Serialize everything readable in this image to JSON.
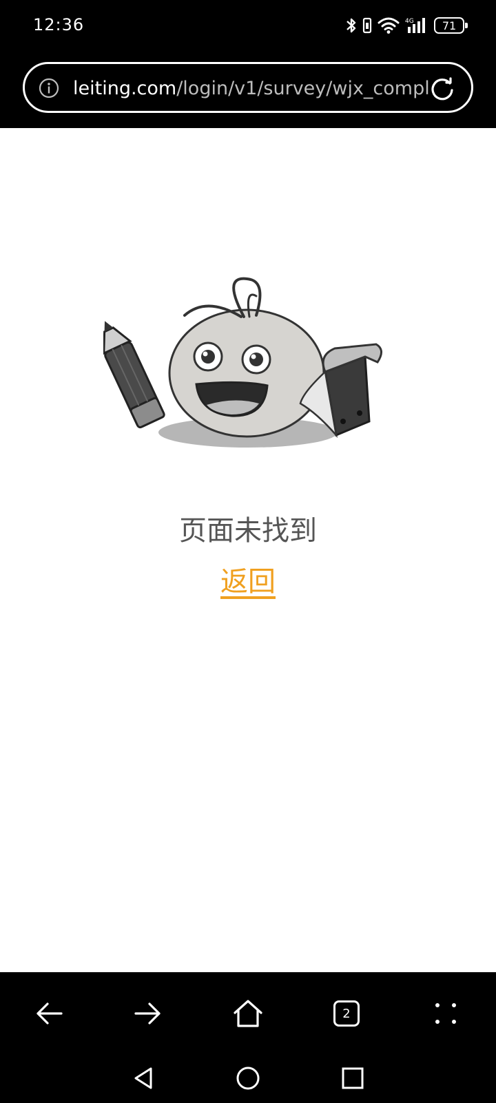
{
  "status_bar": {
    "time": "12:36",
    "network_label": "4G",
    "battery_level": "71",
    "icons": [
      "bluetooth-icon",
      "vibrate-icon",
      "wifi-icon",
      "cellular-signal-icon",
      "battery-icon"
    ]
  },
  "address_bar": {
    "url_domain": "leiting.com",
    "url_path": "/login/v1/survey/wjx_compl",
    "icons": [
      "info-icon",
      "reload-icon"
    ]
  },
  "main": {
    "illustration": "mascot-with-pencil-and-notebook",
    "error_message": "页面未找到",
    "back_link_label": "返回",
    "colors": {
      "link": "#f0a020",
      "message": "#555555"
    }
  },
  "toolbar": {
    "tab_count": "2",
    "icons": [
      "back-arrow-icon",
      "forward-arrow-icon",
      "home-icon",
      "tabs-icon",
      "menu-dots-icon"
    ]
  },
  "system_nav": {
    "icons": [
      "nav-back-triangle-icon",
      "nav-home-circle-icon",
      "nav-recents-square-icon"
    ]
  }
}
